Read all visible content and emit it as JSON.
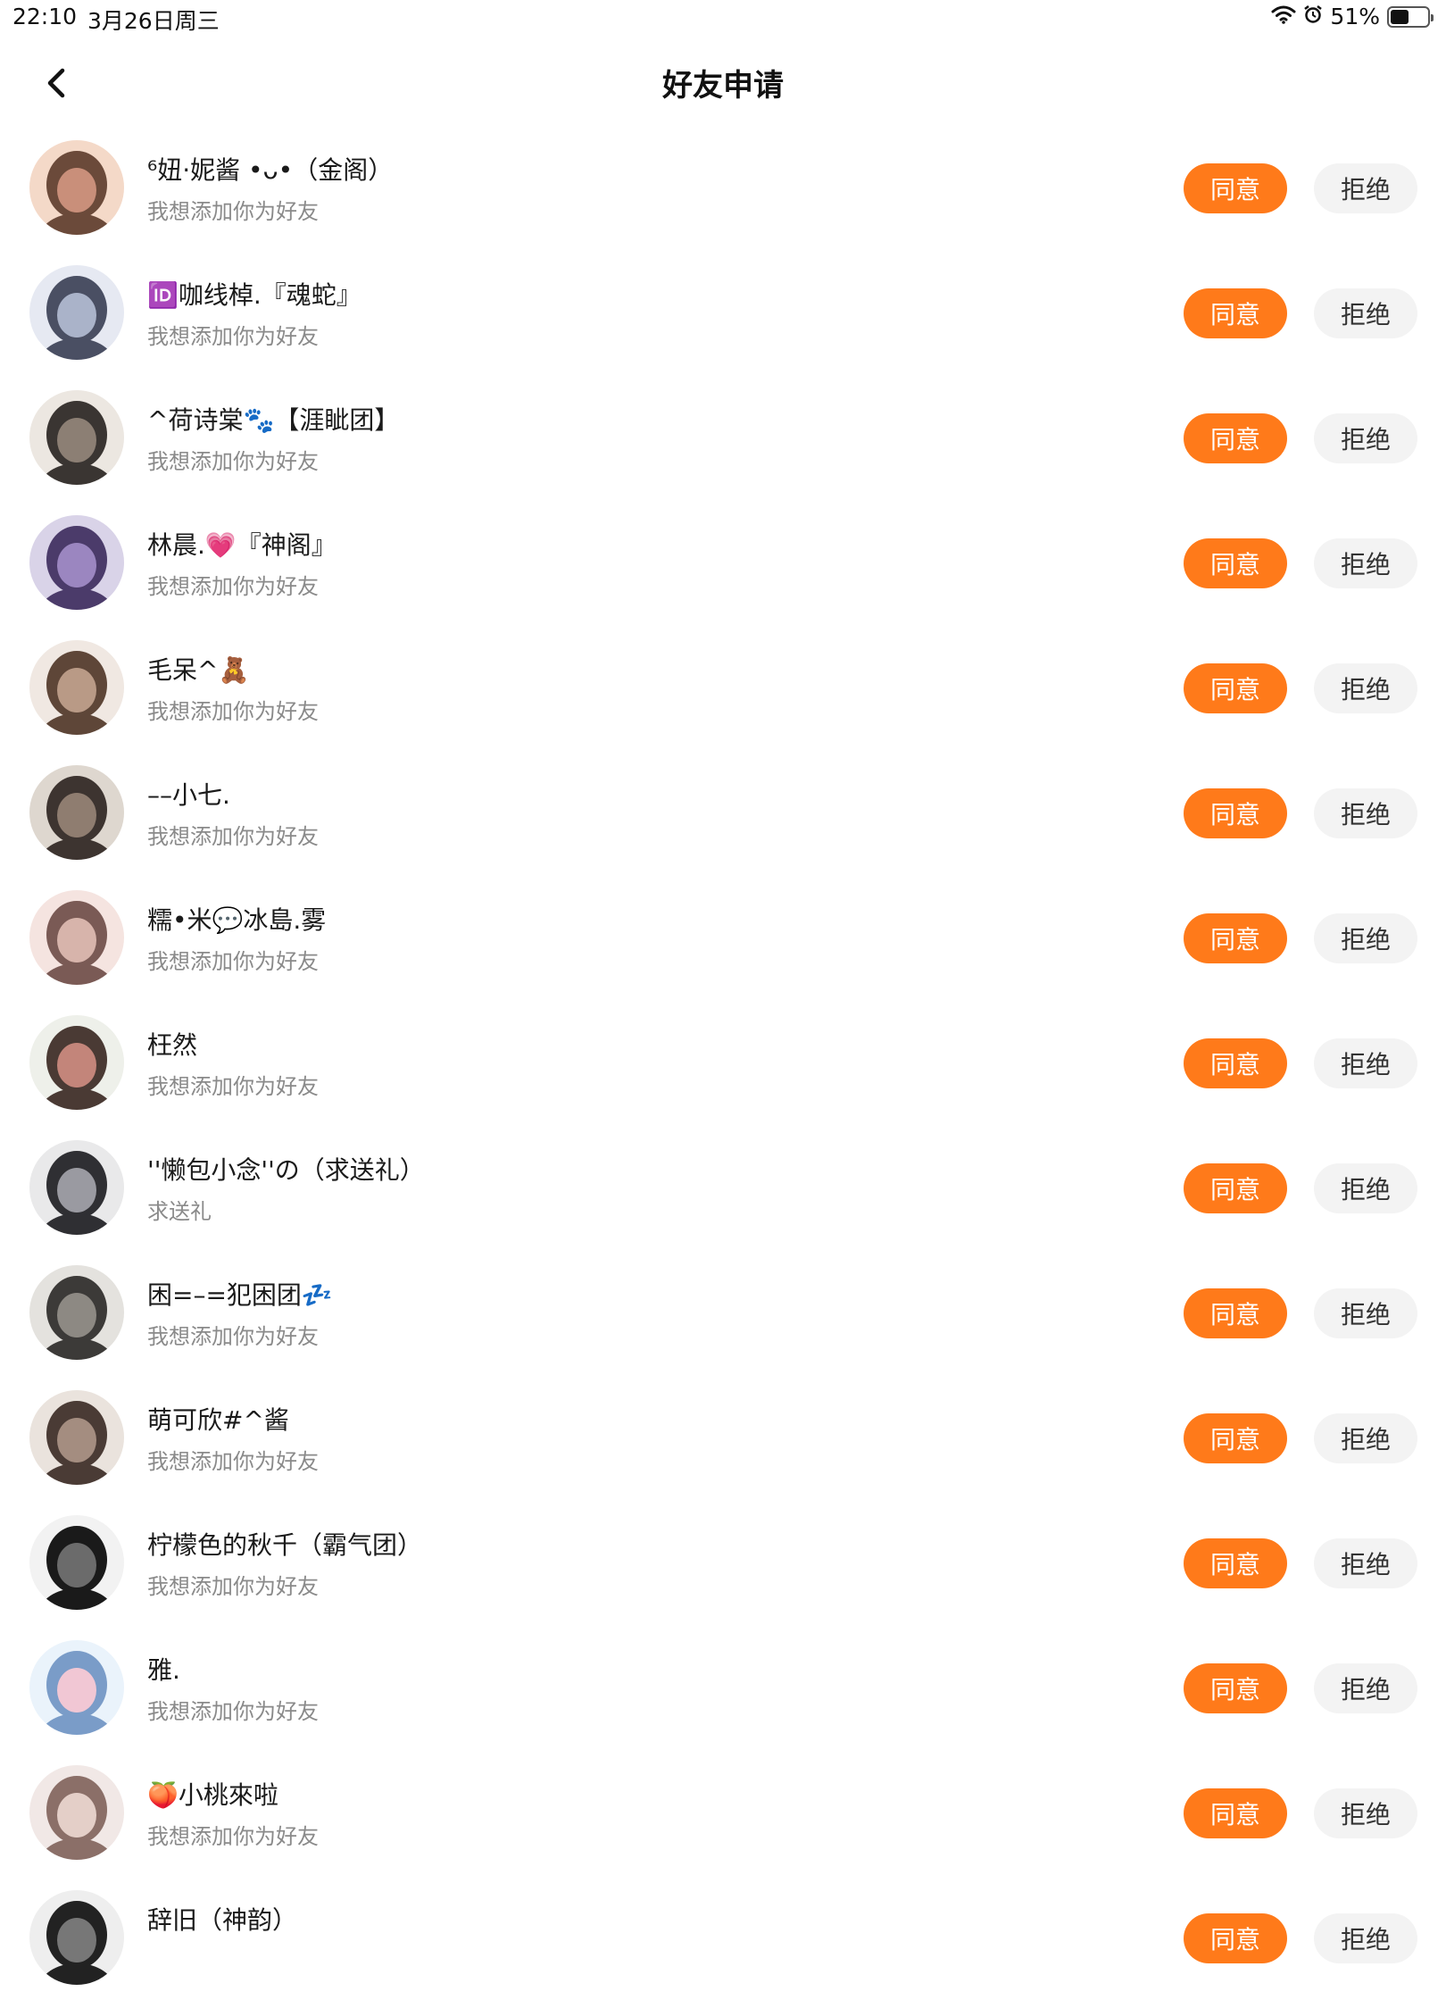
{
  "status": {
    "time": "22:10",
    "date": "3月26日周三",
    "battery_text": "51%",
    "battery_level": 0.51
  },
  "header": {
    "title": "好友申请"
  },
  "colors": {
    "accent": "#FF7A1A",
    "reject_bg": "#F3F3F3"
  },
  "buttons": {
    "accept": "同意",
    "reject": "拒绝"
  },
  "requests": [
    {
      "name": "⁶妞·妮酱 •ᴗ•（金阁）",
      "message": "我想添加你为好友",
      "avatar": "anime-girl-avatar"
    },
    {
      "name": "🆔咖线棹.『魂蛇』",
      "message": "我想添加你为好友",
      "avatar": "anime-girl-avatar"
    },
    {
      "name": "^荷诗棠🐾【涯眦团】",
      "message": "我想添加你为好友",
      "avatar": "photo-avatar"
    },
    {
      "name": "林晨.💗『神阁』",
      "message": "我想添加你为好友",
      "avatar": "anime-girl-avatar"
    },
    {
      "name": "毛呆^🧸",
      "message": "我想添加你为好友",
      "avatar": "anime-girl-avatar"
    },
    {
      "name": "––小七.",
      "message": "我想添加你为好友",
      "avatar": "photo-avatar"
    },
    {
      "name": "糯•米💬冰島.雾",
      "message": "我想添加你为好友",
      "avatar": "photo-avatar"
    },
    {
      "name": "枉然",
      "message": "我想添加你为好友",
      "avatar": "anime-girl-avatar"
    },
    {
      "name": "''懒包小念''の（求送礼）",
      "message": "求送礼",
      "avatar": "photo-avatar"
    },
    {
      "name": "困=–=犯困团💤",
      "message": "我想添加你为好友",
      "avatar": "photo-avatar"
    },
    {
      "name": "萌可欣#^酱",
      "message": "我想添加你为好友",
      "avatar": "photo-avatar"
    },
    {
      "name": "柠檬色的秋千（霸气团）",
      "message": "我想添加你为好友",
      "avatar": "anime-girl-avatar"
    },
    {
      "name": "雅.",
      "message": "我想添加你为好友",
      "avatar": "cartoon-avatar"
    },
    {
      "name": "🍑小桃來啦",
      "message": "我想添加你为好友",
      "avatar": "photo-avatar"
    },
    {
      "name": "辞旧（神韵）",
      "message": "",
      "avatar": "anime-girl-avatar"
    }
  ]
}
